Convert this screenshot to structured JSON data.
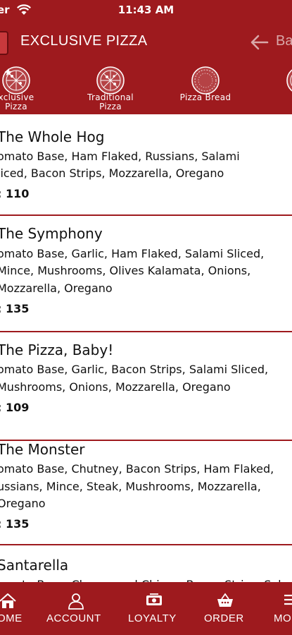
{
  "status_bar": {
    "carrier": "er",
    "time": "11:43 AM"
  },
  "header": {
    "title": "EXCLUSIVE PIZZA",
    "back_label": "Ba"
  },
  "categories": [
    {
      "line1": "xclusive",
      "line2": "Pizza"
    },
    {
      "line1": "Traditional",
      "line2": "Pizza"
    },
    {
      "line1": "Pizza Bread",
      "line2": ""
    },
    {
      "line1": "P",
      "line2": ""
    }
  ],
  "menu_items": [
    {
      "name": "The Whole Hog",
      "desc": [
        "omato Base, Ham Flaked, Russians, Salami",
        "liced, Bacon Strips, Mozzarella, Oregano"
      ],
      "price": ": 110"
    },
    {
      "name": "The Symphony",
      "desc": [
        "omato Base, Garlic, Ham Flaked, Salami Sliced,",
        "Mince, Mushrooms, Olives Kalamata, Onions,",
        "Mozzarella, Oregano"
      ],
      "price": ": 135"
    },
    {
      "name": "The Pizza, Baby!",
      "desc": [
        "omato Base, Garlic, Bacon Strips, Salami Sliced,",
        "Mushrooms, Onions, Mozzarella, Oregano"
      ],
      "price": ": 109"
    },
    {
      "name": "The Monster",
      "desc": [
        "omato Base, Chutney, Bacon Strips, Ham Flaked,",
        "ussians, Mince, Steak, Mushrooms, Mozzarella,",
        "Oregano"
      ],
      "price": ": 135"
    },
    {
      "name": "Santarella",
      "desc": [
        "omato Base, Cheese and Chives, Bacon Strips, Salami"
      ],
      "price": ""
    }
  ],
  "bottom_nav": [
    {
      "label": "OME",
      "icon": "home-icon"
    },
    {
      "label": "ACCOUNT",
      "icon": "account-icon"
    },
    {
      "label": "LOYALTY",
      "icon": "loyalty-icon"
    },
    {
      "label": "ORDER",
      "icon": "basket-icon"
    },
    {
      "label": "MO",
      "icon": "more-icon"
    }
  ],
  "colors": {
    "brand": "#9e1a1e",
    "text": "#111111",
    "background": "#ffffff"
  }
}
